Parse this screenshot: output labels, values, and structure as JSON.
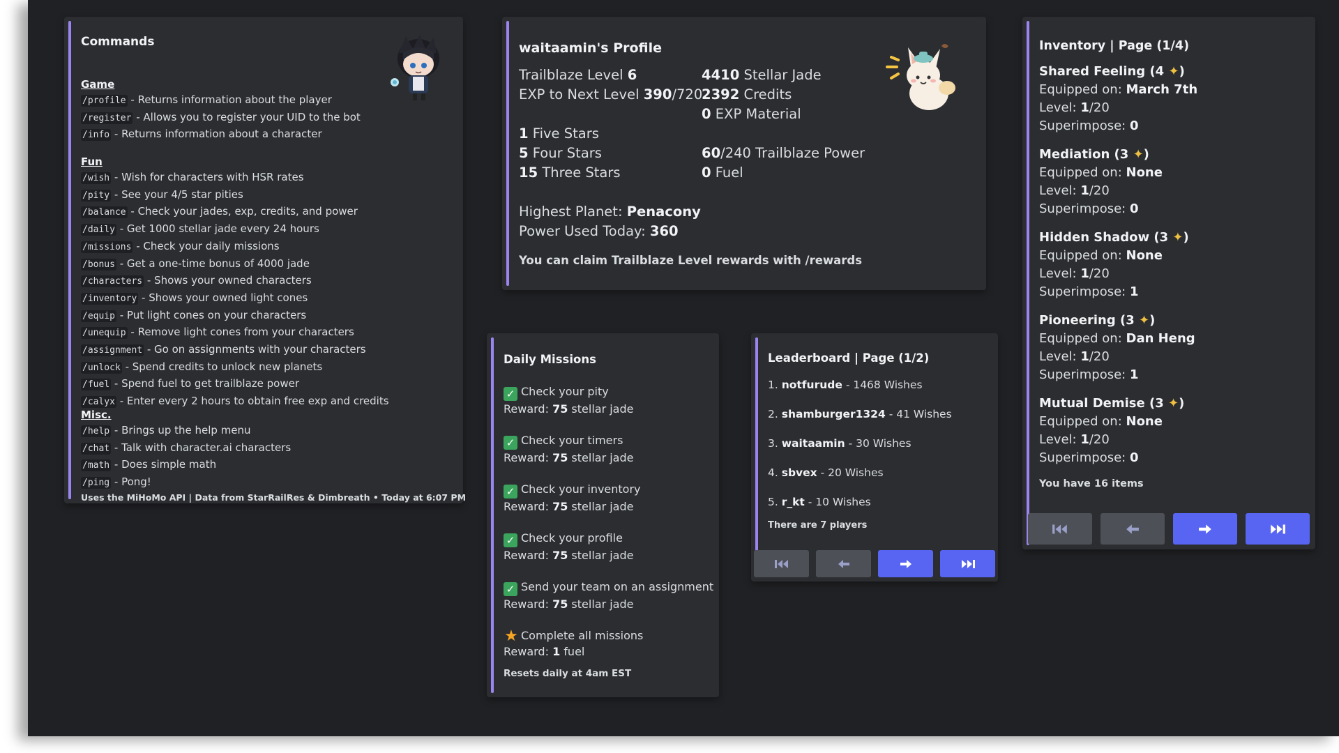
{
  "commands": {
    "title": "Commands",
    "sections": [
      {
        "heading": "Game",
        "items": [
          {
            "cmd": "/profile",
            "desc": " - Returns information about the player"
          },
          {
            "cmd": "/register",
            "desc": " - Allows you to register your UID to the bot"
          },
          {
            "cmd": "/info",
            "desc": " - Returns information about a character"
          }
        ]
      },
      {
        "heading": "Fun",
        "items": [
          {
            "cmd": "/wish",
            "desc": " - Wish for characters with HSR rates"
          },
          {
            "cmd": "/pity",
            "desc": " - See your 4/5 star pities"
          },
          {
            "cmd": "/balance",
            "desc": " - Check your jades, exp, credits, and power"
          },
          {
            "cmd": "/daily",
            "desc": " - Get 1000 stellar jade every 24 hours"
          },
          {
            "cmd": "/missions",
            "desc": " - Check your daily missions"
          },
          {
            "cmd": "/bonus",
            "desc": " - Get a one-time bonus of 4000 jade"
          },
          {
            "cmd": "/characters",
            "desc": " - Shows your owned characters"
          },
          {
            "cmd": "/inventory",
            "desc": " - Shows your owned light cones"
          },
          {
            "cmd": "/equip",
            "desc": " - Put light cones on your characters"
          },
          {
            "cmd": "/unequip",
            "desc": " - Remove light cones from your characters"
          },
          {
            "cmd": "/assignment",
            "desc": " - Go on assignments with your characters"
          },
          {
            "cmd": "/unlock",
            "desc": " - Spend credits to unlock new planets"
          },
          {
            "cmd": "/fuel",
            "desc": " - Spend fuel to get trailblaze power"
          },
          {
            "cmd": "/calyx",
            "desc": " - Enter every 2 hours to obtain free exp and credits"
          }
        ]
      },
      {
        "heading": "Misc.",
        "items": [
          {
            "cmd": "/help",
            "desc": " - Brings up the help menu"
          },
          {
            "cmd": "/chat",
            "desc": " - Talk with character.ai characters"
          },
          {
            "cmd": "/math",
            "desc": " - Does simple math"
          },
          {
            "cmd": "/ping",
            "desc": " - Pong!"
          }
        ]
      }
    ],
    "footer": "Uses the MiHoMo API | Data from StarRailRes & Dimbreath • Today at 6:07 PM"
  },
  "profile": {
    "title": "waitaamin's Profile",
    "trailblaze_label": "Trailblaze Level ",
    "trailblaze_level": "6",
    "exp_label": "EXP to Next Level ",
    "exp_current": "390",
    "exp_max": "/720",
    "stellar_jade_value": "4410",
    "stellar_jade_label": " Stellar Jade",
    "credits_value": "2392",
    "credits_label": " Credits",
    "exp_material_value": "0",
    "exp_material_label": " EXP Material",
    "five_stars_value": "1",
    "five_stars_label": " Five Stars",
    "four_stars_value": "5",
    "four_stars_label": " Four Stars",
    "three_stars_value": "15",
    "three_stars_label": " Three Stars",
    "power_current": "60",
    "power_label": "/240 Trailblaze Power",
    "fuel_value": "0",
    "fuel_label": " Fuel",
    "planet_label": "Highest Planet: ",
    "planet_value": "Penacony",
    "power_used_label": "Power Used Today: ",
    "power_used_value": "360",
    "note": "You can claim Trailblaze Level rewards with /rewards"
  },
  "missions": {
    "title": "Daily Missions",
    "reward_label": "Reward: ",
    "items": [
      {
        "name": "Check your pity",
        "reward_value": "75",
        "reward_unit": " stellar jade",
        "icon": "check-icon"
      },
      {
        "name": "Check your timers",
        "reward_value": "75",
        "reward_unit": " stellar jade",
        "icon": "check-icon"
      },
      {
        "name": "Check your inventory",
        "reward_value": "75",
        "reward_unit": " stellar jade",
        "icon": "check-icon"
      },
      {
        "name": "Check your profile",
        "reward_value": "75",
        "reward_unit": " stellar jade",
        "icon": "check-icon"
      },
      {
        "name": "Send your team on an assignment",
        "reward_value": "75",
        "reward_unit": " stellar jade",
        "icon": "check-icon"
      },
      {
        "name": "Complete all missions",
        "reward_value": "1",
        "reward_unit": " fuel",
        "icon": "star-icon"
      }
    ],
    "footer": "Resets daily at 4am EST"
  },
  "leaderboard": {
    "title": "Leaderboard | Page (1/2)",
    "rows": [
      {
        "rank": "1. ",
        "name": "notfurude",
        "wishes": " - 1468 Wishes"
      },
      {
        "rank": "2. ",
        "name": "shamburger1324",
        "wishes": " - 41 Wishes"
      },
      {
        "rank": "3. ",
        "name": "waitaamin",
        "wishes": " - 30 Wishes"
      },
      {
        "rank": "4. ",
        "name": "sbvex",
        "wishes": " - 20 Wishes"
      },
      {
        "rank": "5. ",
        "name": "r_kt",
        "wishes": " - 10 Wishes"
      }
    ],
    "footer": "There are 7 players"
  },
  "inventory": {
    "title": "Inventory | Page (1/4)",
    "equipped_label": "Equipped on: ",
    "level_label": "Level: ",
    "superimpose_label": "Superimpose: ",
    "items": [
      {
        "name": "Shared Feeling (4 ",
        "star": "✦",
        "close": ")",
        "equipped": "March 7th",
        "level": "1",
        "level_max": "/20",
        "superimpose": "0"
      },
      {
        "name": "Mediation (3 ",
        "star": "✦",
        "close": ")",
        "equipped": "None",
        "level": "1",
        "level_max": "/20",
        "superimpose": "0"
      },
      {
        "name": "Hidden Shadow (3 ",
        "star": "✦",
        "close": ")",
        "equipped": "None",
        "level": "1",
        "level_max": "/20",
        "superimpose": "1"
      },
      {
        "name": "Pioneering (3 ",
        "star": "✦",
        "close": ")",
        "equipped": "Dan Heng",
        "level": "1",
        "level_max": "/20",
        "superimpose": "1"
      },
      {
        "name": "Mutual Demise (3 ",
        "star": "✦",
        "close": ")",
        "equipped": "None",
        "level": "1",
        "level_max": "/20",
        "superimpose": "0"
      }
    ],
    "footer": "You have 16 items"
  },
  "buttons": {
    "first_icon": "skip-first-icon",
    "prev_icon": "arrow-left-icon",
    "next_icon": "arrow-right-icon",
    "last_icon": "skip-last-icon"
  },
  "colors": {
    "background": "#202124",
    "embed": "#2b2d31",
    "accent_bar": "#9b84ee",
    "button_primary": "#5865f2",
    "button_secondary": "#4e5058"
  }
}
